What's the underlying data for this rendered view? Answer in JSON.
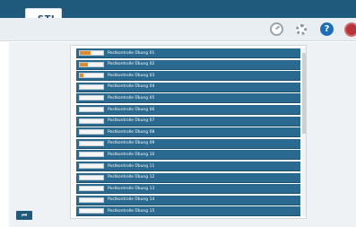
{
  "app": {
    "logo_text": "STI",
    "accent": "#1f5a7d",
    "row_color": "#2a6a90",
    "progress_color": "#e08a2c"
  },
  "toolbar": {
    "dashboard_icon": "dashboard-icon",
    "settings_icon": "gear-icon",
    "help_icon": "help-icon",
    "help_glyph": "?",
    "exit_icon": "exit-icon"
  },
  "exercises": [
    {
      "label": "Postkontrolle Übung 01",
      "progress": 0.45
    },
    {
      "label": "Postkontrolle Übung 02",
      "progress": 0.35
    },
    {
      "label": "Postkontrolle Übung 03",
      "progress": 0.15
    },
    {
      "label": "Postkontrolle Übung 04",
      "progress": 0
    },
    {
      "label": "Postkontrolle Übung 05",
      "progress": 0
    },
    {
      "label": "Postkontrolle Übung 06",
      "progress": 0
    },
    {
      "label": "Postkontrolle Übung 07",
      "progress": 0
    },
    {
      "label": "Postkontrolle Übung 08",
      "progress": 0
    },
    {
      "label": "Postkontrolle Übung 09",
      "progress": 0
    },
    {
      "label": "Postkontrolle Übung 10",
      "progress": 0
    },
    {
      "label": "Postkontrolle Übung 11",
      "progress": 0
    },
    {
      "label": "Postkontrolle Übung 12",
      "progress": 0
    },
    {
      "label": "Postkontrolle Übung 13",
      "progress": 0
    },
    {
      "label": "Postkontrolle Übung 14",
      "progress": 0
    },
    {
      "label": "Postkontrolle Übung 15",
      "progress": 0
    }
  ],
  "nav": {
    "first_glyph": "⏮"
  }
}
